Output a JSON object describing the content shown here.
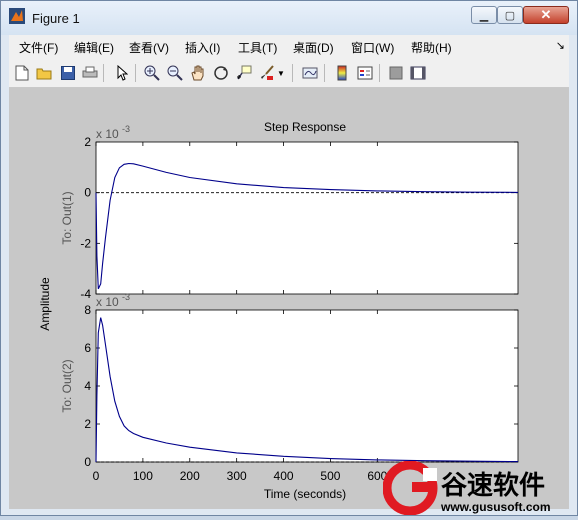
{
  "window": {
    "title": "Figure 1",
    "min_symbol": "▁",
    "max_symbol": "▢",
    "close_symbol": "✕"
  },
  "menu": {
    "items": [
      "文件(F)",
      "编辑(E)",
      "查看(V)",
      "插入(I)",
      "工具(T)",
      "桌面(D)",
      "窗口(W)",
      "帮助(H)"
    ],
    "overflow_symbol": "↘"
  },
  "toolbar": {
    "buttons": [
      "new-file-icon",
      "open-folder-icon",
      "save-icon",
      "print-icon",
      "pointer-icon",
      "zoom-in-icon",
      "zoom-out-icon",
      "pan-hand-icon",
      "rotate-3d-icon",
      "data-cursor-icon",
      "brush-icon",
      "brush-dropdown-icon",
      "link-plot-icon",
      "colorbar-icon",
      "legend-icon",
      "hide-plot-tools-icon",
      "show-plot-tools-icon"
    ]
  },
  "chart_data": {
    "type": "line",
    "title": "Step Response",
    "xlabel": "Time (seconds)",
    "ylabel": "Amplitude",
    "xlim": [
      0,
      900
    ],
    "x_ticks": [
      0,
      100,
      200,
      300,
      400,
      500,
      600
    ],
    "line_color": "#00008b",
    "subplots": [
      {
        "ylabel": "To: Out(1)",
        "scale_label": "x 10",
        "scale_exponent": "-3",
        "ylim": [
          -4,
          2
        ],
        "y_ticks": [
          2,
          0,
          -2,
          -4
        ],
        "reference_line": 0,
        "x": [
          0,
          2,
          5,
          10,
          14,
          20,
          30,
          40,
          50,
          60,
          70,
          80,
          100,
          150,
          200,
          300,
          400,
          500,
          600,
          700,
          800,
          900
        ],
        "y": [
          0,
          -2.5,
          -3.8,
          -3.6,
          -2.8,
          -1.8,
          -0.3,
          0.6,
          0.98,
          1.12,
          1.15,
          1.14,
          1.05,
          0.8,
          0.6,
          0.35,
          0.2,
          0.12,
          0.07,
          0.04,
          0.02,
          0.01
        ]
      },
      {
        "ylabel": "To: Out(2)",
        "scale_label": "x 10",
        "scale_exponent": "-3",
        "ylim": [
          0,
          8
        ],
        "y_ticks": [
          8,
          6,
          4,
          2,
          0
        ],
        "reference_line": 0,
        "x": [
          0,
          2,
          5,
          10,
          14,
          20,
          30,
          40,
          50,
          60,
          70,
          80,
          100,
          150,
          200,
          300,
          400,
          500,
          600,
          700,
          800,
          900
        ],
        "y": [
          0,
          3.5,
          6.8,
          7.6,
          7.2,
          6.2,
          4.5,
          3.2,
          2.4,
          1.9,
          1.65,
          1.5,
          1.3,
          1.0,
          0.78,
          0.48,
          0.3,
          0.18,
          0.11,
          0.07,
          0.04,
          0.02
        ]
      }
    ]
  },
  "watermark": {
    "brand_cn": "谷速软件",
    "url": "www.gususoft.com",
    "logo_color": "#e01a22"
  }
}
